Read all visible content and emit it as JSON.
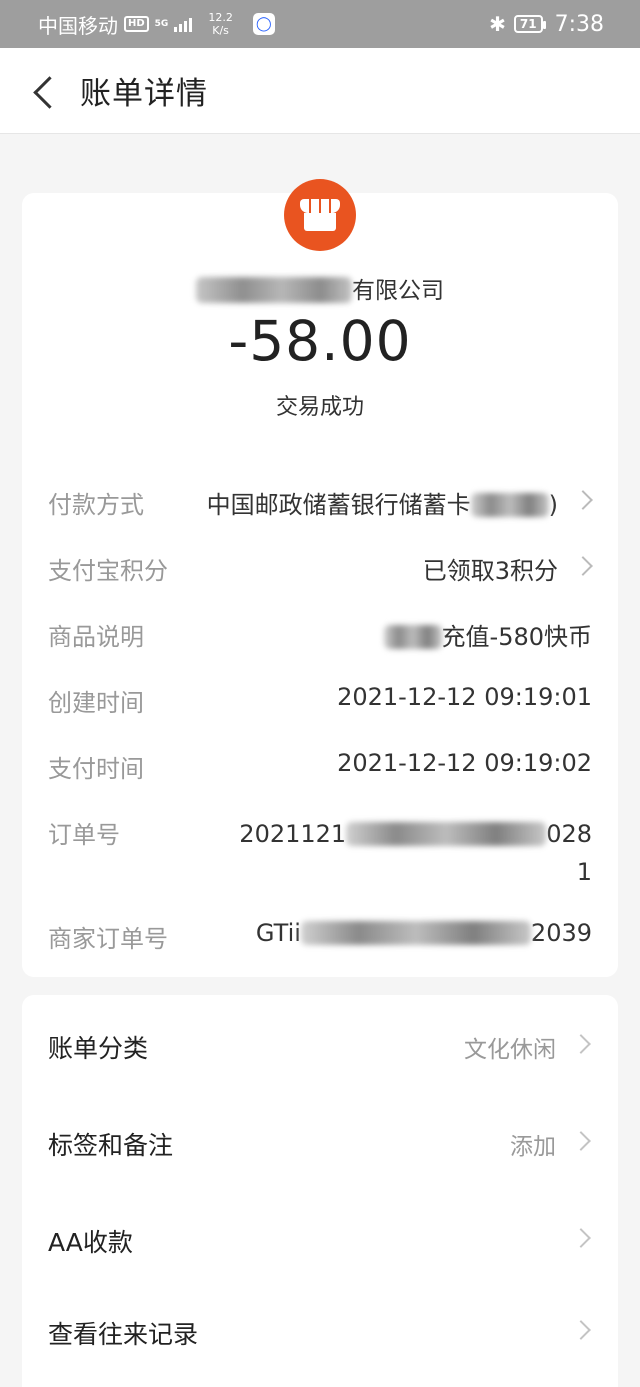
{
  "status_bar": {
    "carrier": "中国移动",
    "hd": "HD",
    "network": "5G",
    "speed": "12.2",
    "speed_unit": "K/s",
    "battery": "71",
    "time": "7:38"
  },
  "nav": {
    "title": "账单详情"
  },
  "summary": {
    "merchant_suffix": "有限公司",
    "amount": "-58.00",
    "status": "交易成功"
  },
  "details": [
    {
      "label": "付款方式",
      "value": "中国邮政储蓄银行储蓄卡",
      "value_tail": ")"
    },
    {
      "label": "支付宝积分",
      "value": "已领取3积分"
    },
    {
      "label": "商品说明",
      "value": "充值-580快币"
    },
    {
      "label": "创建时间",
      "value": "2021-12-12 09:19:01"
    },
    {
      "label": "支付时间",
      "value": "2021-12-12 09:19:02"
    },
    {
      "label": "订单号",
      "value_head": "2021121",
      "value_tail": "028",
      "value_line2": "1"
    },
    {
      "label": "商家订单号",
      "value_head": "GTii",
      "value_tail": "2039"
    }
  ],
  "actions": [
    {
      "label": "账单分类",
      "value": "文化休闲"
    },
    {
      "label": "标签和备注",
      "value": "添加"
    },
    {
      "label": "AA收款",
      "value": ""
    },
    {
      "label": "查看往来记录",
      "value": ""
    }
  ],
  "colors": {
    "merchant_icon": "#e95420",
    "status_bar": "#9e9e9e"
  }
}
